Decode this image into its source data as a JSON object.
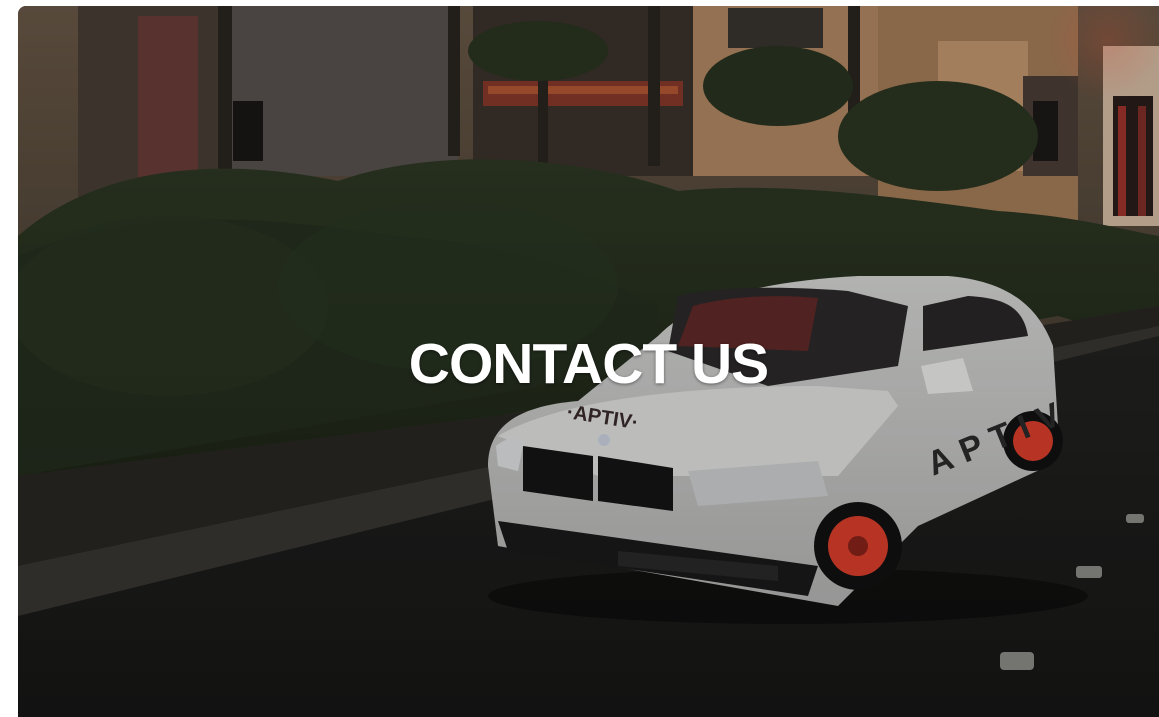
{
  "hero": {
    "title": "CONTACT US",
    "image_alt": "White APTIV self-driving car driving at dusk",
    "brand_text_hood": "·APTIV·",
    "brand_text_door": "APTIV"
  },
  "colors": {
    "title_text": "#ffffff",
    "overlay": "rgba(0,0,0,0.18)",
    "accent_red": "#e0402c"
  }
}
